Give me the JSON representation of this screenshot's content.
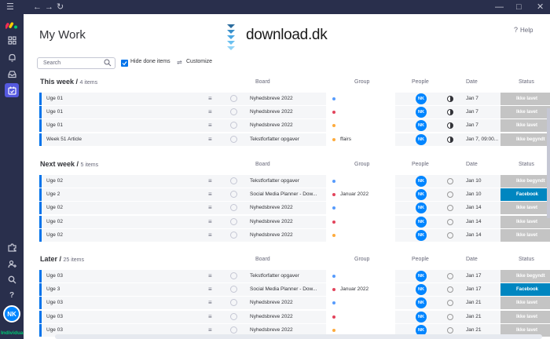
{
  "window": {
    "nav_icons": [
      "hamburger-icon",
      "back-arrow-icon",
      "forward-arrow-icon",
      "reload-icon"
    ],
    "controls": [
      "minimize-icon",
      "maximize-icon",
      "close-icon"
    ]
  },
  "rail": {
    "logo": "monday-logo",
    "top_icons": [
      "apps-grid-icon",
      "bell-icon",
      "inbox-icon",
      "my-work-icon"
    ],
    "bottom_icons": [
      "puzzle-icon",
      "invite-user-icon",
      "search-icon",
      "help-icon"
    ],
    "avatar": "NK",
    "plan": "Individual"
  },
  "page": {
    "title": "My Work",
    "help": "Help"
  },
  "watermark": {
    "brand": "download",
    "tld": ".dk"
  },
  "toolbar": {
    "search_placeholder": "Search",
    "hide_done": "Hide done items",
    "customize": "Customize"
  },
  "columns": {
    "board": "Board",
    "group": "Group",
    "people": "People",
    "date": "Date",
    "status": "Status"
  },
  "colors": {
    "accent": "#0073ea",
    "status_gray": "#c4c4c4",
    "status_blue": "#0086c0",
    "avatar": "#0085ff"
  },
  "sections": [
    {
      "title": "This week /",
      "count": "4 items",
      "rows": [
        {
          "name": "Uge 01",
          "board": "Nyhedsbreve 2022",
          "group": "",
          "dot": "#579bfc",
          "date_icon": "half",
          "date": "Jan 7",
          "status": "Ikke lavet",
          "status_color": "#c4c4c4"
        },
        {
          "name": "Uge 01",
          "board": "Nyhedsbreve 2022",
          "group": "",
          "dot": "#e2445c",
          "date_icon": "half",
          "date": "Jan 7",
          "status": "Ikke lavet",
          "status_color": "#c4c4c4"
        },
        {
          "name": "Uge 01",
          "board": "Nyhedsbreve 2022",
          "group": "",
          "dot": "#fdab3d",
          "date_icon": "half",
          "date": "Jan 7",
          "status": "Ikke lavet",
          "status_color": "#c4c4c4"
        },
        {
          "name": "Week 51 Article",
          "board": "Tekstforfatter opgaver",
          "group": "ffairs",
          "dot": "#fdab3d",
          "date_icon": "half",
          "date": "Jan 7, 09:00...",
          "status": "Ikke begyndt",
          "status_color": "#c4c4c4"
        }
      ]
    },
    {
      "title": "Next week /",
      "count": "5 items",
      "rows": [
        {
          "name": "Uge 02",
          "board": "Tekstforfatter opgaver",
          "group": "",
          "dot": "#579bfc",
          "date_icon": "empty",
          "date": "Jan 10",
          "status": "Ikke begyndt",
          "status_color": "#c4c4c4"
        },
        {
          "name": "Uge 2",
          "board": "Social Media Planner - Dow...",
          "group": "Januar 2022",
          "dot": "#e2445c",
          "date_icon": "empty",
          "date": "Jan 10",
          "status": "Facebook",
          "status_color": "#0086c0"
        },
        {
          "name": "Uge 02",
          "board": "Nyhedsbreve 2022",
          "group": "",
          "dot": "#579bfc",
          "date_icon": "empty",
          "date": "Jan 14",
          "status": "Ikke lavet",
          "status_color": "#c4c4c4"
        },
        {
          "name": "Uge 02",
          "board": "Nyhedsbreve 2022",
          "group": "",
          "dot": "#e2445c",
          "date_icon": "empty",
          "date": "Jan 14",
          "status": "Ikke lavet",
          "status_color": "#c4c4c4"
        },
        {
          "name": "Uge 02",
          "board": "Nyhedsbreve 2022",
          "group": "",
          "dot": "#fdab3d",
          "date_icon": "empty",
          "date": "Jan 14",
          "status": "Ikke lavet",
          "status_color": "#c4c4c4"
        }
      ]
    },
    {
      "title": "Later /",
      "count": "25 items",
      "rows": [
        {
          "name": "Uge 03",
          "board": "Tekstforfatter opgaver",
          "group": "",
          "dot": "#579bfc",
          "date_icon": "empty",
          "date": "Jan 17",
          "status": "Ikke begyndt",
          "status_color": "#c4c4c4"
        },
        {
          "name": "Uge 3",
          "board": "Social Media Planner - Dow...",
          "group": "Januar 2022",
          "dot": "#e2445c",
          "date_icon": "empty",
          "date": "Jan 17",
          "status": "Facebook",
          "status_color": "#0086c0"
        },
        {
          "name": "Uge 03",
          "board": "Nyhedsbreve 2022",
          "group": "",
          "dot": "#579bfc",
          "date_icon": "empty",
          "date": "Jan 21",
          "status": "Ikke lavet",
          "status_color": "#c4c4c4"
        },
        {
          "name": "Uge 03",
          "board": "Nyhedsbreve 2022",
          "group": "",
          "dot": "#e2445c",
          "date_icon": "empty",
          "date": "Jan 21",
          "status": "Ikke lavet",
          "status_color": "#c4c4c4"
        },
        {
          "name": "Uge 03",
          "board": "Nyhedsbreve 2022",
          "group": "",
          "dot": "#fdab3d",
          "date_icon": "empty",
          "date": "Jan 21",
          "status": "Ikke lavet",
          "status_color": "#c4c4c4"
        }
      ]
    }
  ]
}
